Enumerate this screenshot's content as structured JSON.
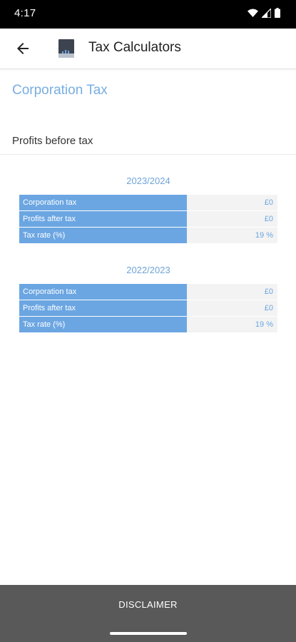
{
  "status_bar": {
    "time": "4:17"
  },
  "app_bar": {
    "title": "Tax Calculators"
  },
  "section": {
    "title": "Corporation Tax"
  },
  "input": {
    "label": "Profits before tax",
    "value": "",
    "placeholder": ""
  },
  "years": [
    {
      "heading": "2023/2024",
      "rows": [
        {
          "label": "Corporation tax",
          "value": "£0"
        },
        {
          "label": "Profits after tax",
          "value": "£0"
        },
        {
          "label": "Tax rate (%)",
          "value": "19 %"
        }
      ]
    },
    {
      "heading": "2022/2023",
      "rows": [
        {
          "label": "Corporation tax",
          "value": "£0"
        },
        {
          "label": "Profits after tax",
          "value": "£0"
        },
        {
          "label": "Tax rate (%)",
          "value": "19 %"
        }
      ]
    }
  ],
  "footer": {
    "disclaimer_label": "DISCLAIMER"
  },
  "colors": {
    "accent": "#78aee0",
    "table_label_bg": "#6ba6e2",
    "table_value_bg": "#f3f3f3",
    "footer_bg": "#595959"
  },
  "icons": {
    "back": "arrow-left-icon",
    "app": "calculator-app-icon",
    "wifi": "wifi-icon",
    "signal": "signal-icon",
    "battery": "battery-icon"
  }
}
